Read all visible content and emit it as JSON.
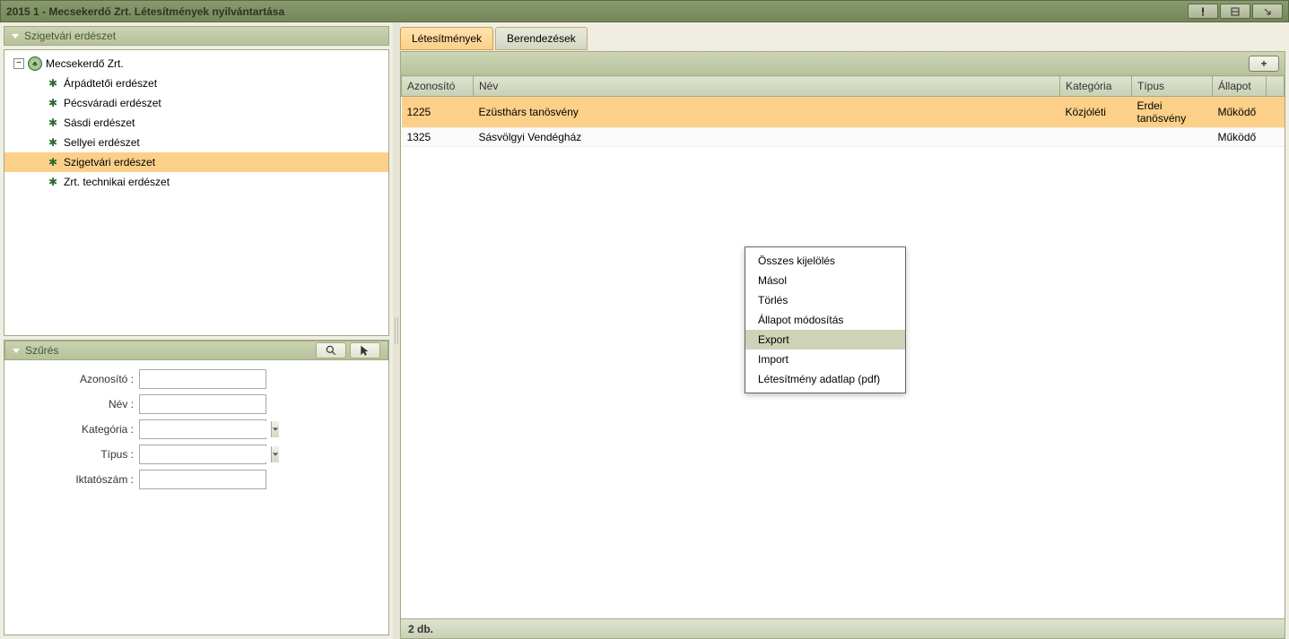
{
  "title": "2015 1 - Mecsekerdő Zrt. Létesítmények nyilvántartása",
  "sidebar": {
    "tree_header": "Szigetvári erdészet",
    "root_label": "Mecsekerdő Zrt.",
    "children": [
      "Árpádtetői erdészet",
      "Pécsváradi erdészet",
      "Sásdi erdészet",
      "Sellyei erdészet",
      "Szigetvári erdészet",
      "Zrt. technikai erdészet"
    ],
    "selected_child_index": 4
  },
  "filter": {
    "header": "Szűrés",
    "fields": {
      "azonosito_label": "Azonosító :",
      "nev_label": "Név :",
      "kategoria_label": "Kategória :",
      "tipus_label": "Típus :",
      "iktatoszam_label": "Iktatószám :"
    }
  },
  "tabs": [
    {
      "label": "Létesítmények",
      "active": true
    },
    {
      "label": "Berendezések",
      "active": false
    }
  ],
  "grid": {
    "columns": [
      "Azonosító",
      "Név",
      "Kategória",
      "Típus",
      "Állapot"
    ],
    "rows": [
      {
        "azonosito": "1225",
        "nev": "Ezüsthárs tanösvény",
        "kategoria": "Közjóléti",
        "tipus": "Erdei tanösvény",
        "allapot": "Működő",
        "selected": true
      },
      {
        "azonosito": "1325",
        "nev": "Sásvölgyi Vendégház",
        "kategoria": "",
        "tipus": "",
        "allapot": "Működő",
        "selected": false
      }
    ],
    "footer": "2 db."
  },
  "context_menu": {
    "items": [
      "Összes kijelölés",
      "Másol",
      "Törlés",
      "Állapot módosítás",
      "Export",
      "Import",
      "Létesítmény adatlap (pdf)"
    ],
    "highlighted_index": 4
  }
}
